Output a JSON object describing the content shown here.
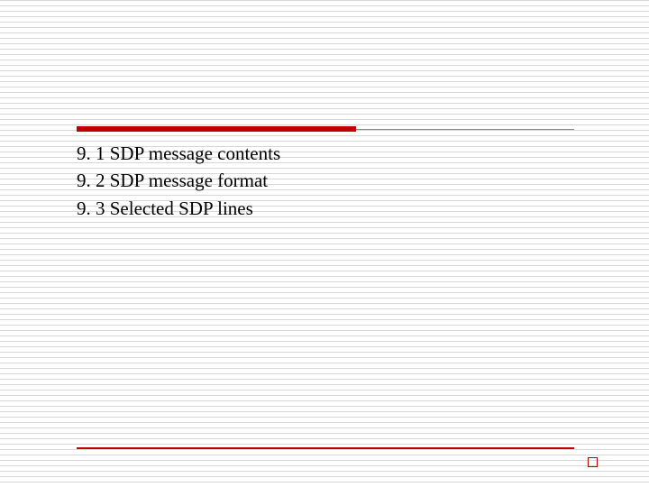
{
  "items": [
    "9. 1 SDP message contents",
    "9. 2 SDP message format",
    "9. 3 Selected SDP lines"
  ]
}
